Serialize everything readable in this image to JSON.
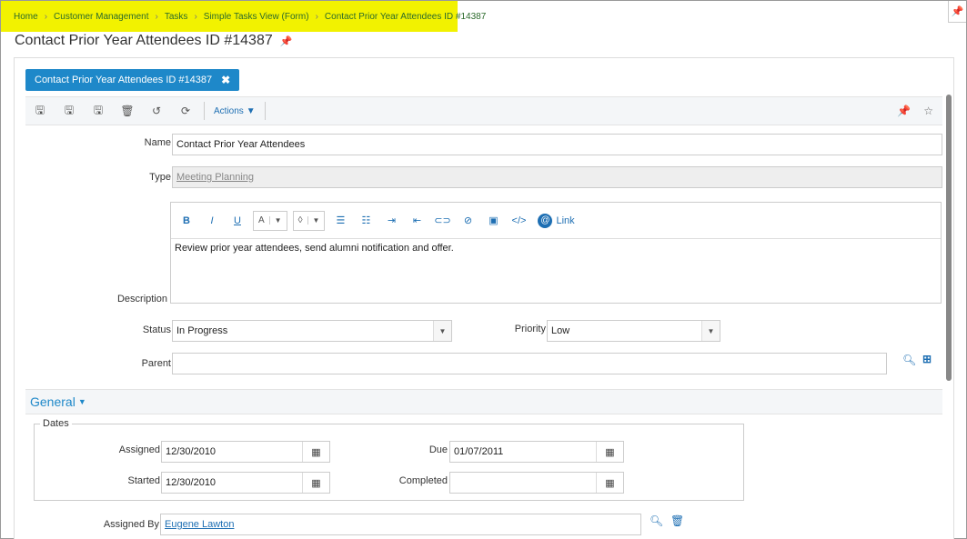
{
  "breadcrumb": [
    "Home",
    "Customer Management",
    "Tasks",
    "Simple Tasks View (Form)",
    "Contact Prior Year Attendees ID #14387"
  ],
  "page_title": "Contact Prior Year Attendees ID #14387",
  "tab": {
    "label": "Contact Prior Year Attendees ID #14387"
  },
  "toolbar": {
    "actions_label": "Actions"
  },
  "form": {
    "name_label": "Name",
    "name_value": "Contact Prior Year Attendees",
    "type_label": "Type",
    "type_value": "Meeting Planning",
    "description_label": "Description",
    "description_value": "Review prior year attendees, send alumni notification and offer.",
    "editor_link_label": "Link",
    "status_label": "Status",
    "status_value": "In Progress",
    "priority_label": "Priority",
    "priority_value": "Low",
    "parent_label": "Parent",
    "parent_value": ""
  },
  "general": {
    "title": "General",
    "dates_legend": "Dates",
    "assigned_label": "Assigned",
    "assigned_value": "12/30/2010",
    "due_label": "Due",
    "due_value": "01/07/2011",
    "started_label": "Started",
    "started_value": "12/30/2010",
    "completed_label": "Completed",
    "completed_value": "",
    "assigned_by_label": "Assigned By",
    "assigned_by_value": "Eugene Lawton"
  },
  "colors": {
    "accent": "#1e88c9",
    "breadcrumb_bg": "#f2f200"
  }
}
